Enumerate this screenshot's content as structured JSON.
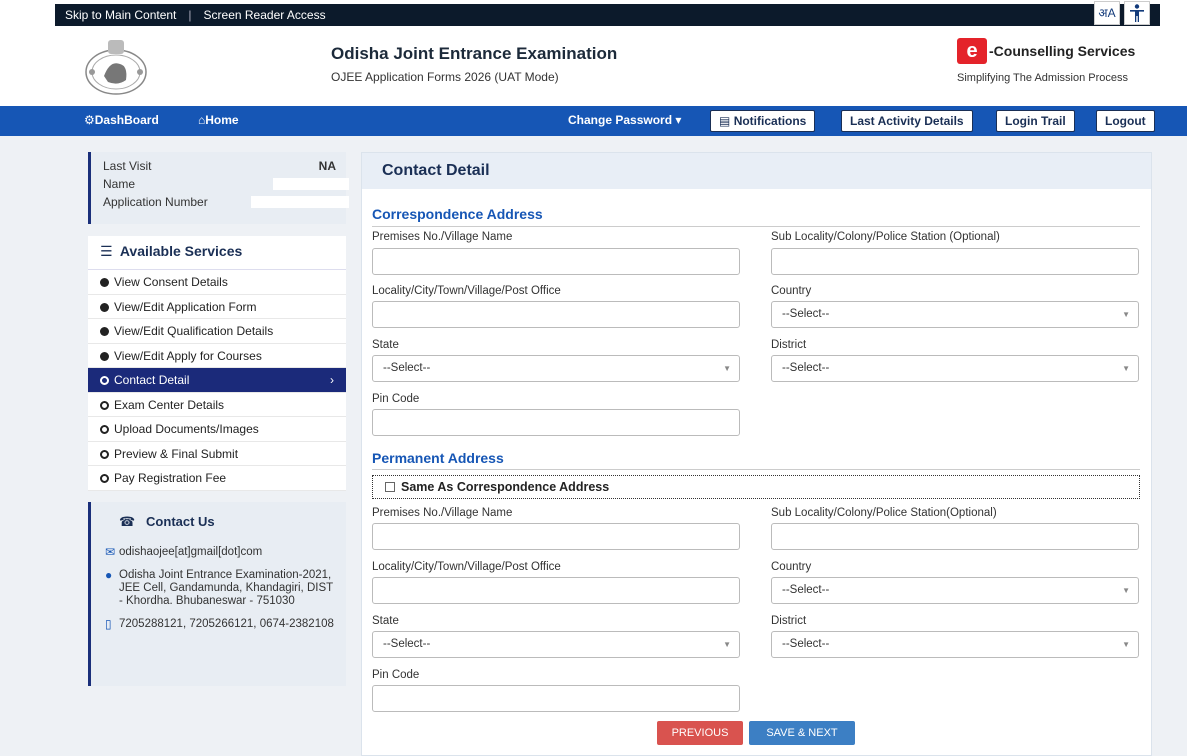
{
  "topbar": {
    "skip": "Skip to Main Content",
    "sep": "|",
    "reader": "Screen Reader Access",
    "lang_icon": "अA"
  },
  "header": {
    "title": "Odisha Joint Entrance Examination",
    "subtitle": "OJEE Application Forms 2026 (UAT Mode)",
    "brand_letter": "e",
    "brand_name": "-Counselling Services",
    "brand_tagline": "Simplifying The Admission Process"
  },
  "nav": {
    "dashboard": "DashBoard",
    "home": "Home",
    "change_password": "Change Password",
    "notifications": "Notifications",
    "last_activity": "Last Activity Details",
    "login_trail": "Login Trail",
    "logout": "Logout"
  },
  "profile": {
    "last_visit_label": "Last Visit",
    "last_visit_value": "NA",
    "name_label": "Name",
    "app_no_label": "Application Number"
  },
  "services": {
    "heading": "Available Services",
    "items": [
      {
        "label": "View Consent Details",
        "state": "done"
      },
      {
        "label": "View/Edit Application Form",
        "state": "done"
      },
      {
        "label": "View/Edit Qualification Details",
        "state": "done"
      },
      {
        "label": "View/Edit Apply for Courses",
        "state": "done"
      },
      {
        "label": "Contact Detail",
        "state": "active"
      },
      {
        "label": "Exam Center Details",
        "state": "pending"
      },
      {
        "label": "Upload Documents/Images",
        "state": "pending"
      },
      {
        "label": "Preview & Final Submit",
        "state": "pending"
      },
      {
        "label": "Pay Registration Fee",
        "state": "pending"
      }
    ]
  },
  "contact": {
    "heading": "Contact Us",
    "email": "odishaojee[at]gmail[dot]com",
    "address": "Odisha Joint Entrance Examination-2021, JEE Cell, Gandamunda, Khandagiri, DIST - Khordha. Bhubaneswar - 751030",
    "phones": "7205288121, 7205266121, 0674-2382108"
  },
  "form": {
    "heading": "Contact Detail",
    "correspondence": {
      "title": "Correspondence Address",
      "premises_label": "Premises No./Village Name",
      "sublocality_label": "Sub Locality/Colony/Police Station (Optional)",
      "locality_label": "Locality/City/Town/Village/Post Office",
      "country_label": "Country",
      "country_value": "--Select--",
      "state_label": "State",
      "state_value": "--Select--",
      "district_label": "District",
      "district_value": "--Select--",
      "pin_label": "Pin Code"
    },
    "permanent": {
      "title": "Permanent Address",
      "same_as": "Same As Correspondence Address",
      "premises_label": "Premises No./Village Name",
      "sublocality_label": "Sub Locality/Colony/Police Station(Optional)",
      "locality_label": "Locality/City/Town/Village/Post Office",
      "country_label": "Country",
      "country_value": "--Select--",
      "state_label": "State",
      "state_value": "--Select--",
      "district_label": "District",
      "district_value": "--Select--",
      "pin_label": "Pin Code"
    },
    "previous": "PREVIOUS",
    "save_next": "SAVE & NEXT"
  },
  "colors": {
    "nav": "#1656b5",
    "active_item": "#1b2a7a",
    "previous_btn": "#d9534f",
    "save_btn": "#3c7fc4"
  }
}
